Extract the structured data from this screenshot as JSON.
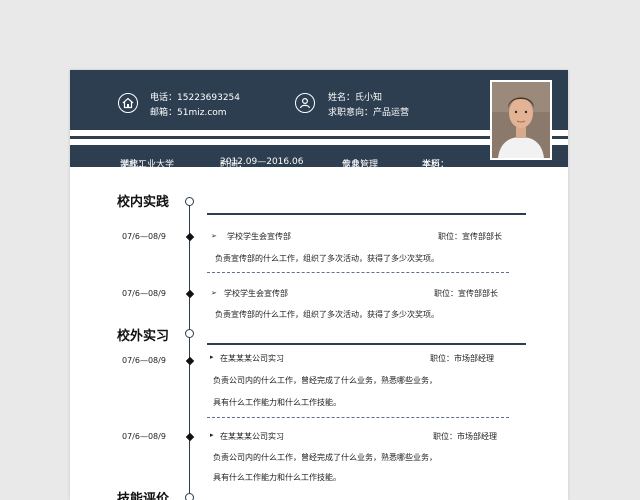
{
  "header": {
    "phone_label": "电话：",
    "phone": "15223693254",
    "email_label": "邮箱：",
    "email": "51miz.com",
    "name_label": "姓名：",
    "name": "氏小知",
    "intent_label": "求职意向：",
    "intent": "产品运营"
  },
  "education": {
    "school_label": "学校：",
    "school": "湖北工业大学",
    "time_label": "时间：",
    "time": "2012.09—2016.06",
    "major_label": "专业：",
    "major": "信息管理",
    "degree_label": "学历：",
    "degree": "本科"
  },
  "sections": [
    {
      "title": "校内实践",
      "entries": [
        {
          "date": "07/6—08/9",
          "org": "学校学生会宣传部",
          "position": "职位：宣传部部长",
          "lines": [
            "负责宣传部的什么工作，组织了多次活动，获得了多少次奖项。"
          ]
        },
        {
          "date": "07/6—08/9",
          "org": "学校学生会宣传部",
          "position": "职位：宣传部部长",
          "lines": [
            "负责宣传部的什么工作，组织了多次活动，获得了多少次奖项。"
          ]
        }
      ]
    },
    {
      "title": "校外实习",
      "entries": [
        {
          "date": "07/6—08/9",
          "org": "在某某某公司实习",
          "position": "职位：市场部经理",
          "lines": [
            "负责公司内的什么工作，曾经完成了什么业务，熟悉哪些业务，",
            "具有什么工作能力和什么工作技能。"
          ]
        },
        {
          "date": "07/6—08/9",
          "org": "在某某某公司实习",
          "position": "职位：市场部经理",
          "lines": [
            "负责公司内的什么工作，曾经完成了什么业务，熟悉哪些业务，",
            "具有什么工作能力和什么工作技能。"
          ]
        }
      ]
    },
    {
      "title": "技能评价"
    }
  ],
  "icons": {
    "home": "home-icon",
    "user": "user-icon",
    "bullet": "arrow-bullet-icon"
  },
  "colors": {
    "primary": "#2d3e50",
    "divider": "#5d6f99"
  }
}
